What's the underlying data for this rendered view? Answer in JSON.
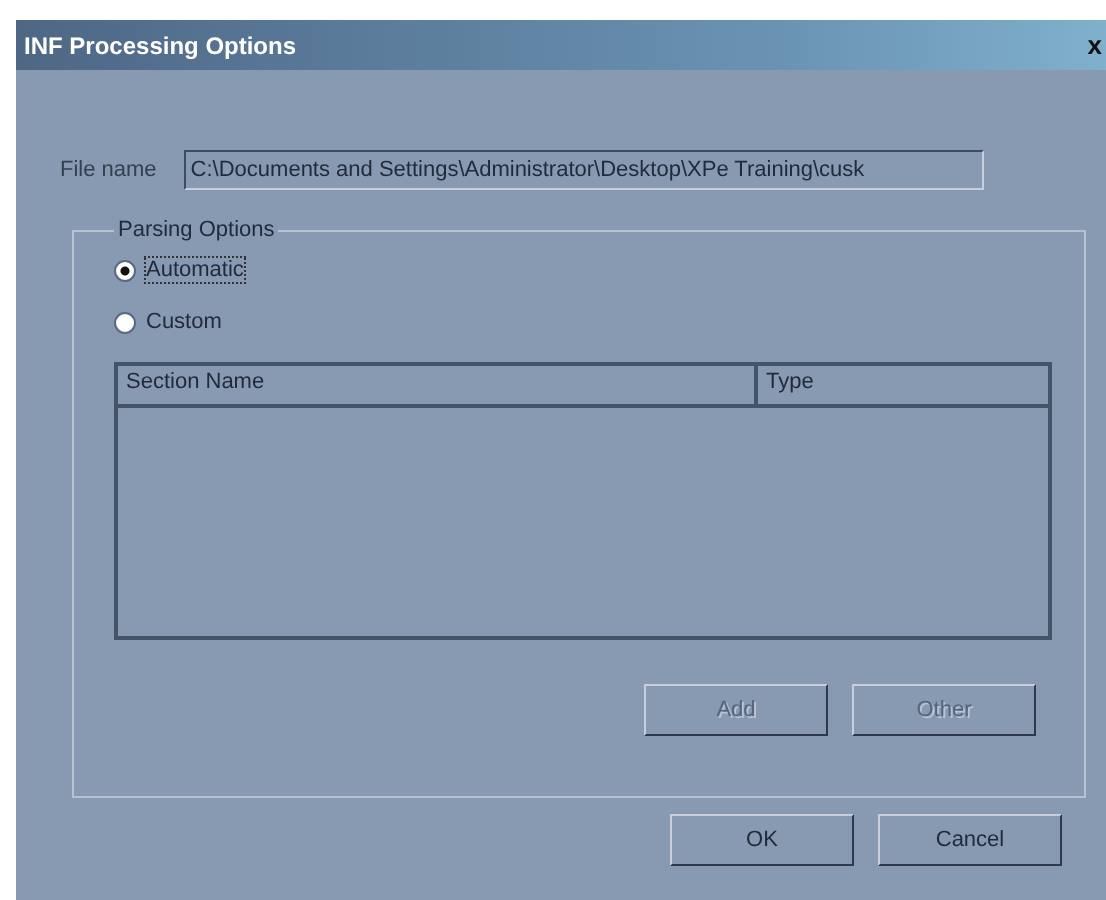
{
  "window": {
    "title": "INF Processing Options",
    "close": "x"
  },
  "file_name": {
    "label": "File name",
    "value": "C:\\Documents and Settings\\Administrator\\Desktop\\XPe Training\\cusk"
  },
  "parsing_options": {
    "title": "Parsing Options",
    "radios": [
      {
        "label": "Automatic",
        "selected": true
      },
      {
        "label": "Custom",
        "selected": false
      }
    ],
    "table": {
      "columns": [
        "Section Name",
        "Type"
      ]
    },
    "buttons": [
      {
        "label": "Add",
        "disabled": true
      },
      {
        "label": "Other",
        "disabled": true
      }
    ]
  },
  "buttons": [
    {
      "label": "OK",
      "disabled": false
    },
    {
      "label": "Cancel",
      "disabled": false
    }
  ]
}
